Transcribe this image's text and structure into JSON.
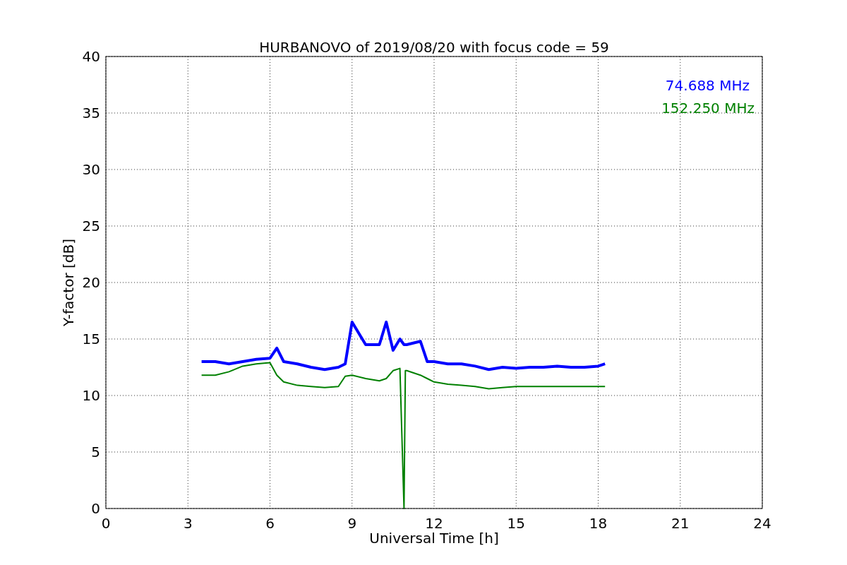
{
  "chart_data": {
    "type": "line",
    "title": "HURBANOVO of 2019/08/20 with focus code = 59",
    "xlabel": "Universal Time [h]",
    "ylabel": "Y-factor [dB]",
    "x": [
      3.5,
      4,
      4.5,
      5,
      5.5,
      6,
      6.25,
      6.5,
      7,
      7.5,
      8,
      8.5,
      8.75,
      9,
      9.5,
      10,
      10.25,
      10.5,
      10.75,
      10.9,
      10.95,
      11,
      11.5,
      11.75,
      12,
      12.5,
      13,
      13.5,
      14,
      14.5,
      15,
      15.5,
      16,
      16.5,
      17,
      17.5,
      18,
      18.25
    ],
    "series": [
      {
        "name": "74.688 MHz",
        "color": "#0000ff",
        "values": [
          13,
          13,
          12.8,
          13,
          13.2,
          13.3,
          14.2,
          13,
          12.8,
          12.5,
          12.3,
          12.5,
          12.8,
          16.5,
          14.5,
          14.5,
          16.5,
          14,
          15,
          14.5,
          14.5,
          14.5,
          14.8,
          13,
          13,
          12.8,
          12.8,
          12.6,
          12.3,
          12.5,
          12.4,
          12.5,
          12.5,
          12.6,
          12.5,
          12.5,
          12.6,
          12.8
        ]
      },
      {
        "name": "152.250 MHz",
        "color": "#008000",
        "values": [
          11.8,
          11.8,
          12.1,
          12.6,
          12.8,
          12.9,
          11.8,
          11.2,
          10.9,
          10.8,
          10.7,
          10.8,
          11.7,
          11.8,
          11.5,
          11.3,
          11.5,
          12.2,
          12.4,
          0,
          12.2,
          12.2,
          11.8,
          11.5,
          11.2,
          11,
          10.9,
          10.8,
          10.6,
          10.7,
          10.8,
          10.8,
          10.8,
          10.8,
          10.8,
          10.8,
          10.8,
          10.8
        ]
      }
    ],
    "xlim": [
      0,
      24
    ],
    "ylim": [
      0,
      40
    ],
    "xticks": [
      0,
      3,
      6,
      9,
      12,
      15,
      18,
      21,
      24
    ],
    "yticks": [
      0,
      5,
      10,
      15,
      20,
      25,
      30,
      35,
      40
    ],
    "grid": true
  }
}
